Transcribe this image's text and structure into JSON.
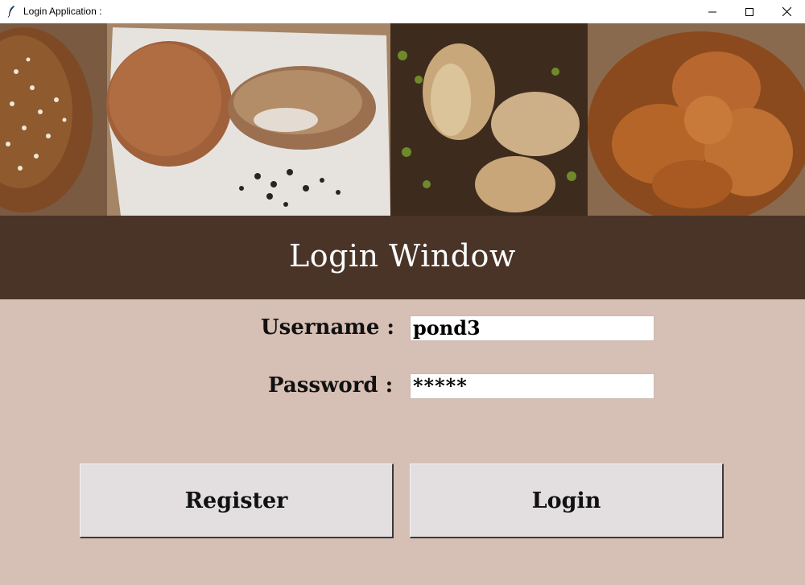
{
  "window": {
    "title": "Login Application :",
    "icons": [
      "feather-icon",
      "minimize-icon",
      "maximize-icon",
      "close-icon"
    ]
  },
  "banner": {
    "description_icons": [
      "bread-banner-image"
    ]
  },
  "header": {
    "title": "Login Window"
  },
  "form": {
    "username_label": "Username :",
    "username_value": "pond3",
    "password_label": "Password :",
    "password_value": "*****"
  },
  "actions": {
    "register_label": "Register",
    "login_label": "Login"
  },
  "colors": {
    "background": "#d6bfb4",
    "header_band": "#4a3428",
    "button_face": "#e3dfe0"
  }
}
